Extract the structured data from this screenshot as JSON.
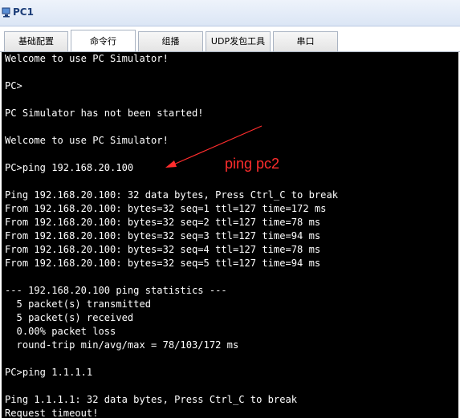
{
  "window": {
    "title": "PC1",
    "icon": "pc-app-icon"
  },
  "tabs": [
    {
      "label": "基础配置",
      "active": false
    },
    {
      "label": "命令行",
      "active": true
    },
    {
      "label": "组播",
      "active": false
    },
    {
      "label": "UDP发包工具",
      "active": false
    },
    {
      "label": "串口",
      "active": false
    }
  ],
  "console": {
    "lines": [
      "Welcome to use PC Simulator!",
      "",
      "PC>",
      "",
      "PC Simulator has not been started!",
      "",
      "Welcome to use PC Simulator!",
      "",
      "PC>ping 192.168.20.100",
      "",
      "Ping 192.168.20.100: 32 data bytes, Press Ctrl_C to break",
      "From 192.168.20.100: bytes=32 seq=1 ttl=127 time=172 ms",
      "From 192.168.20.100: bytes=32 seq=2 ttl=127 time=78 ms",
      "From 192.168.20.100: bytes=32 seq=3 ttl=127 time=94 ms",
      "From 192.168.20.100: bytes=32 seq=4 ttl=127 time=78 ms",
      "From 192.168.20.100: bytes=32 seq=5 ttl=127 time=94 ms",
      "",
      "--- 192.168.20.100 ping statistics ---",
      "  5 packet(s) transmitted",
      "  5 packet(s) received",
      "  0.00% packet loss",
      "  round-trip min/avg/max = 78/103/172 ms",
      "",
      "PC>ping 1.1.1.1",
      "",
      "Ping 1.1.1.1: 32 data bytes, Press Ctrl_C to break",
      "Request timeout!"
    ]
  },
  "annotation": {
    "label": "ping pc2",
    "color": "#ff2d2d"
  },
  "colors": {
    "console_bg": "#000000",
    "console_fg": "#ffffff",
    "title_fg": "#1c3d78"
  }
}
